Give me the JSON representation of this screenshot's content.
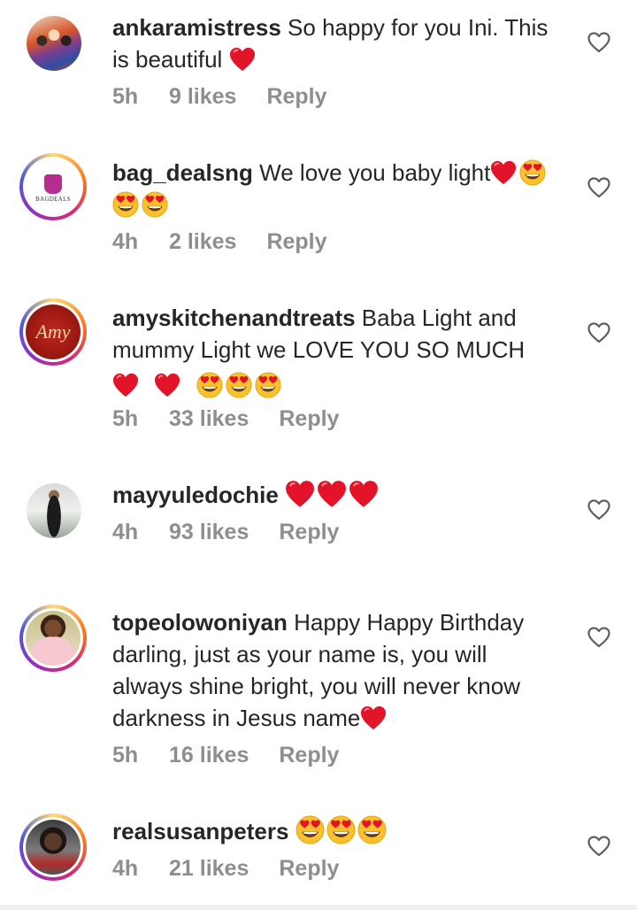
{
  "comments": [
    {
      "username": "ankaramistress",
      "text": "So happy for you Ini. This is beautiful",
      "emojis": "❤️",
      "time": "5h",
      "likes": "9 likes",
      "reply": "Reply"
    },
    {
      "username": "bag_dealsng",
      "text": "We love you baby light",
      "emojis": "❤️😍😍😍",
      "time": "4h",
      "likes": "2 likes",
      "reply": "Reply",
      "avatar_text": "BAGDEALS"
    },
    {
      "username": "amyskitchenandtreats",
      "text": "Baba Light and mummy Light we LOVE YOU SO MUCH",
      "emojis": "❤️ ❤️ 😍😍😍",
      "time": "5h",
      "likes": "33 likes",
      "reply": "Reply",
      "avatar_text": "Amy"
    },
    {
      "username": "mayyuledochie",
      "text": "",
      "emojis": "❤️❤️❤️",
      "time": "4h",
      "likes": "93 likes",
      "reply": "Reply"
    },
    {
      "username": "topeolowoniyan",
      "text": "Happy Happy Birthday darling, just as your name is, you will always shine bright, you will never know darkness in Jesus name",
      "emojis": "❤️",
      "time": "5h",
      "likes": "16 likes",
      "reply": "Reply"
    },
    {
      "username": "realsusanpeters",
      "text": "",
      "emojis": "😍😍😍",
      "time": "4h",
      "likes": "21 likes",
      "reply": "Reply"
    }
  ],
  "colors": {
    "text": "#262626",
    "meta": "#8e8e8e",
    "heart_emoji": "#ed1c24",
    "heart_eyes_face": "#ffcc4d"
  },
  "icons": {
    "like": "heart-outline-icon"
  }
}
